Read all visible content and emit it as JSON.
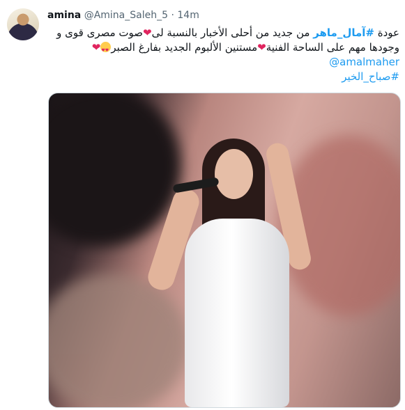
{
  "user": {
    "name": "amina",
    "handle": "@Amina_Saleh_5",
    "separator": "·",
    "time": "14m"
  },
  "tweet": {
    "line1": {
      "pre": "عودة ",
      "hashtag": "#آمال_ماهر",
      "text_a": " من جديد من أحلى الأخبار بالنسبة لى",
      "text_b": "صوت مصرى قوى و"
    },
    "line2": {
      "text_a": "وجودها مهم على الساحة الفنية",
      "text_b": "مستنين الألبوم الجديد بفارغ الصبر"
    },
    "mention": "@amalmaher",
    "hashtag2": "#صباح_الخير"
  },
  "colors": {
    "link": "#1d9bf0",
    "heart": "#e0245e"
  },
  "icons": {
    "heart": "heart-icon",
    "emoji": "heart-eyes-emoji-icon"
  }
}
